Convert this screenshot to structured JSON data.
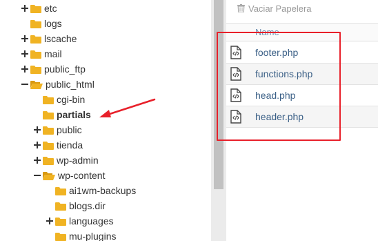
{
  "tree": {
    "items": [
      {
        "label": "etc",
        "toggle": "plus",
        "bold": false
      },
      {
        "label": "logs",
        "toggle": "none",
        "bold": false
      },
      {
        "label": "lscache",
        "toggle": "plus",
        "bold": false
      },
      {
        "label": "mail",
        "toggle": "plus",
        "bold": false
      },
      {
        "label": "public_ftp",
        "toggle": "plus",
        "bold": false
      },
      {
        "label": "public_html",
        "toggle": "minus",
        "bold": false
      },
      {
        "label": "cgi-bin",
        "toggle": "none",
        "bold": false
      },
      {
        "label": "partials",
        "toggle": "none",
        "bold": true
      },
      {
        "label": "public",
        "toggle": "plus",
        "bold": false
      },
      {
        "label": "tienda",
        "toggle": "plus",
        "bold": false
      },
      {
        "label": "wp-admin",
        "toggle": "plus",
        "bold": false
      },
      {
        "label": "wp-content",
        "toggle": "minus",
        "bold": false
      },
      {
        "label": "ai1wm-backups",
        "toggle": "none",
        "bold": false
      },
      {
        "label": "blogs.dir",
        "toggle": "none",
        "bold": false
      },
      {
        "label": "languages",
        "toggle": "plus",
        "bold": false
      },
      {
        "label": "mu-plugins",
        "toggle": "none",
        "bold": false
      }
    ]
  },
  "toolbar": {
    "empty_trash_label": "Vaciar Papelera",
    "trash_icon": "trash-icon"
  },
  "file_list": {
    "header_name": "Name",
    "files": [
      {
        "name": "footer.php",
        "icon": "php-file-icon"
      },
      {
        "name": "functions.php",
        "icon": "php-file-icon"
      },
      {
        "name": "head.php",
        "icon": "php-file-icon"
      },
      {
        "name": "header.php",
        "icon": "php-file-icon"
      }
    ]
  },
  "colors": {
    "folder": "#f0b323",
    "annotation_red": "#e8202a",
    "file_link": "#3a5f86",
    "header_text": "#6d8fb0"
  }
}
